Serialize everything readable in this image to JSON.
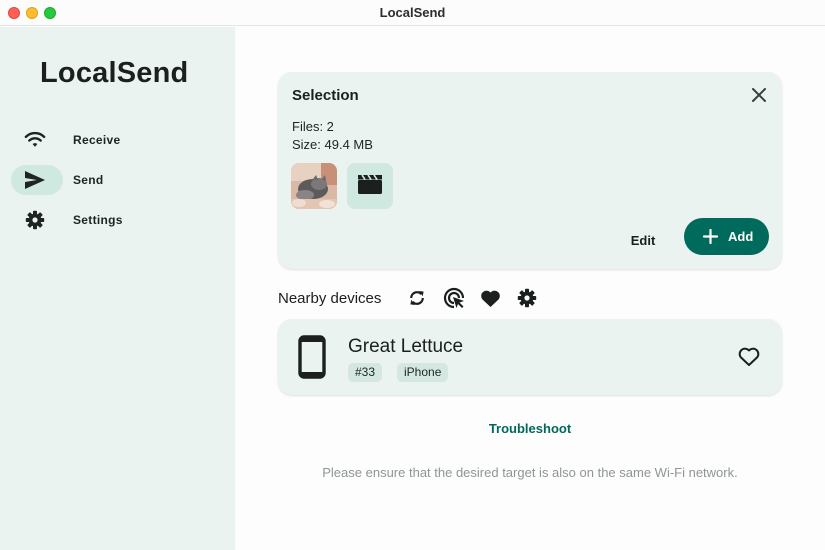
{
  "window": {
    "title": "LocalSend"
  },
  "sidebar": {
    "brand": "LocalSend",
    "items": [
      {
        "label": "Receive",
        "icon": "wifi-icon",
        "active": false
      },
      {
        "label": "Send",
        "icon": "send-icon",
        "active": true
      },
      {
        "label": "Settings",
        "icon": "gear-icon",
        "active": false
      }
    ]
  },
  "selection": {
    "title": "Selection",
    "files_text": "Files: 2",
    "size_text": "Size: 49.4 MB",
    "thumbnails": [
      {
        "kind": "photo",
        "icon": "cat-photo"
      },
      {
        "kind": "video",
        "icon": "clapperboard-icon"
      }
    ],
    "edit_label": "Edit",
    "add_label": "Add"
  },
  "nearby": {
    "label": "Nearby devices",
    "icons": [
      "refresh-icon",
      "scan-target-icon",
      "heart-icon",
      "gear-icon"
    ],
    "devices": [
      {
        "name": "Great Lettuce",
        "id_tag": "#33",
        "type_tag": "iPhone",
        "favorite": false
      }
    ]
  },
  "troubleshoot_label": "Troubleshoot",
  "hint_text": "Please ensure that the desired target is also on the same Wi-Fi network.",
  "colors": {
    "accent": "#006b5c",
    "sidebar_bg": "#eaf3ef",
    "card_bg": "#eaf3ef",
    "active_pill": "#cfe8e0",
    "link": "#00695c",
    "hint": "#8f9694"
  }
}
